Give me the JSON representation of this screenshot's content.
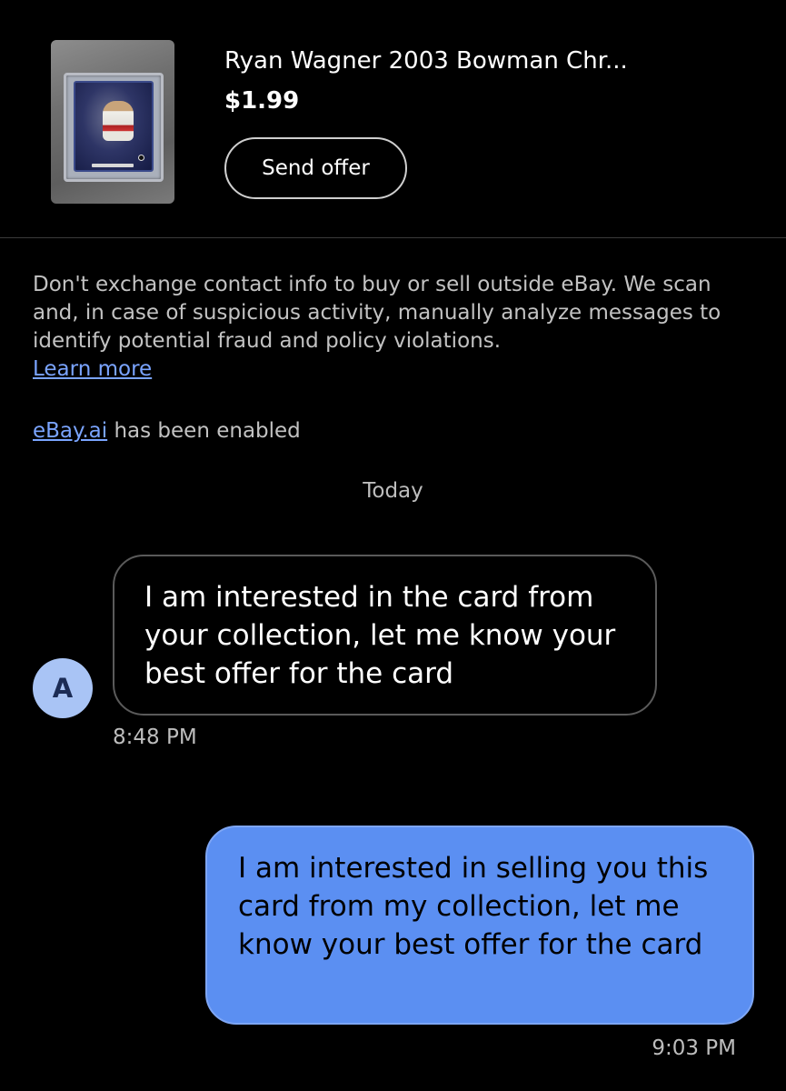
{
  "listing": {
    "title": "Ryan Wagner 2003 Bowman Chr...",
    "price": "$1.99",
    "send_offer_label": "Send offer",
    "thumbnail_icon": "trading-card-thumbnail"
  },
  "notice": {
    "text": "Don't exchange contact info to buy or sell outside eBay. We scan and, in case of suspicious activity, manually analyze messages to identify potential fraud and policy violations.",
    "learn_more_label": "Learn more"
  },
  "ai_notice": {
    "link_label": "eBay.ai",
    "text": " has been enabled"
  },
  "date_separator": "Today",
  "messages": [
    {
      "direction": "incoming",
      "avatar_initial": "A",
      "text": "I am interested in the card from your collection, let me know your best offer for the card",
      "time": "8:48 PM"
    },
    {
      "direction": "outgoing",
      "text": "I am interested in selling you this card from my collection, let me know your best offer for the card",
      "time": "9:03 PM"
    }
  ],
  "colors": {
    "background": "#000000",
    "link": "#7aa4ff",
    "outgoing_bubble": "#5b8ff2",
    "avatar": "#a9c4f5"
  }
}
